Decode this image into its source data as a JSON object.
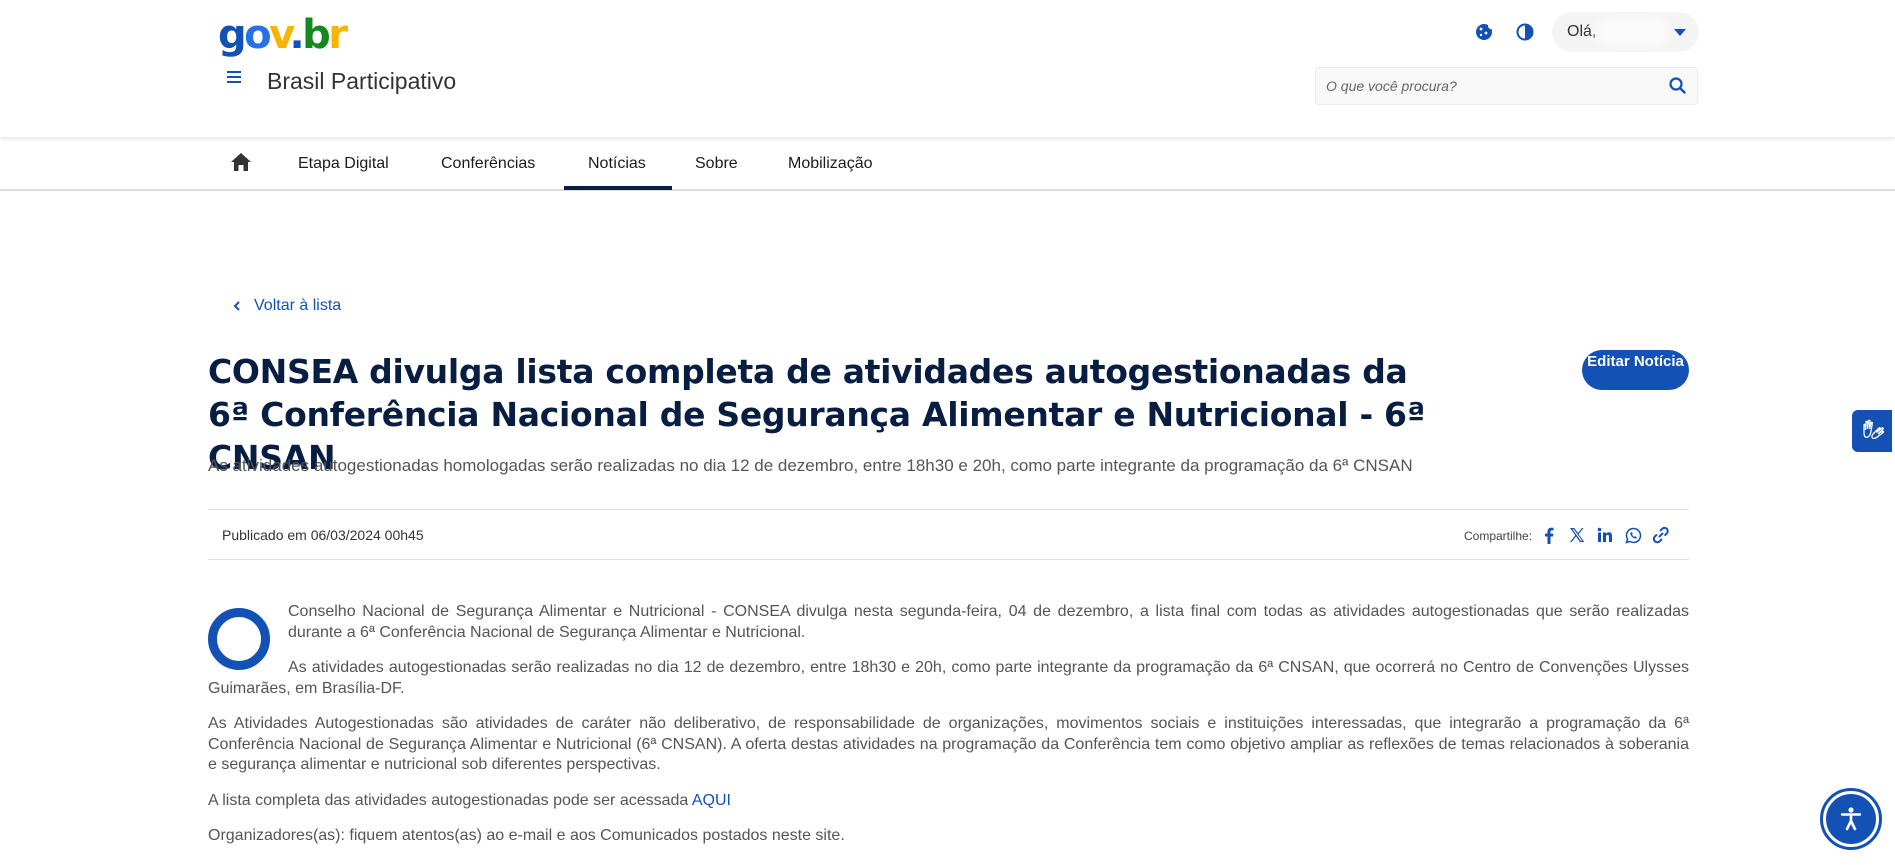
{
  "header": {
    "logo": {
      "g": "g",
      "o": "o",
      "v": "v",
      "dot": ".",
      "b": "b",
      "r": "r"
    },
    "site_title": "Brasil Participativo",
    "greeting": "Olá,",
    "search_placeholder": "O que você procura?",
    "icons": [
      "cookie-icon",
      "contrast-icon",
      "chevron-down-icon",
      "menu-icon",
      "search-icon"
    ]
  },
  "nav": {
    "items": [
      {
        "label": "Etapa Digital"
      },
      {
        "label": "Conferências"
      },
      {
        "label": "Notícias",
        "active": true
      },
      {
        "label": "Sobre"
      },
      {
        "label": "Mobilização"
      }
    ]
  },
  "article": {
    "back_label": "Voltar à lista",
    "title": "CONSEA divulga lista completa de atividades autogestionadas da 6ª Conferência Nacional de Segurança Alimentar e Nutricional - 6ª CNSAN",
    "edit_label": "Editar Notícia",
    "subtitle": "As atividades autogestionadas homologadas serão realizadas no dia 12 de dezembro, entre 18h30 e 20h, como parte integrante da programação da 6ª CNSAN",
    "published": "Publicado em 06/03/2024 00h45",
    "share_label": "Compartilhe:",
    "share_icons": [
      "facebook-icon",
      "x-icon",
      "linkedin-icon",
      "whatsapp-icon",
      "link-icon"
    ],
    "paragraphs": [
      "Conselho Nacional de Segurança Alimentar e Nutricional - CONSEA divulga nesta segunda-feira, 04 de dezembro, a lista final com todas as atividades autogestionadas que serão realizadas durante a 6ª Conferência Nacional de Segurança Alimentar e Nutricional.",
      "As atividades autogestionadas serão realizadas no dia 12 de dezembro, entre 18h30 e 20h, como parte integrante da programação da 6ª CNSAN, que ocorrerá no Centro de Convenções Ulysses Guimarães, em Brasília-DF.",
      "As Atividades Autogestionadas são atividades de caráter não deliberativo, de responsabilidade de organizações, movimentos sociais e instituições interessadas, que integrarão a programação da 6ª Conferência Nacional de Segurança Alimentar e Nutricional (6ª CNSAN). A oferta destas atividades na programação da Conferência tem como objetivo ampliar as reflexões de temas relacionados à soberania e segurança alimentar e nutricional sob diferentes perspectivas.",
      "A lista completa das atividades autogestionadas pode ser acessada ",
      "Organizadores(as): fiquem atentos(as) ao e-mail e aos Comunicados postados neste site."
    ],
    "link_label": "AQUI"
  },
  "floating": {
    "icons": [
      "sign-language-icon",
      "accessibility-icon"
    ]
  },
  "colors": {
    "primary": "#1351b4",
    "title": "#071d41",
    "nav_active": "#071d41",
    "logo_yellow": "#f8b500",
    "logo_green": "#168821"
  }
}
